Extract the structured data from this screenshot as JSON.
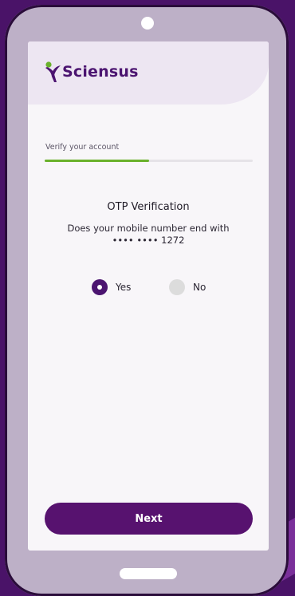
{
  "brand": {
    "name": "Sciensus",
    "primary_color": "#4b1470",
    "accent_color": "#6ab12c",
    "logo_icon": "sciensus-figure-icon"
  },
  "progress": {
    "label": "Verify your account",
    "fraction": 0.5
  },
  "otp": {
    "title": "OTP Verification",
    "question": "Does your mobile number end with",
    "masked_number": "•••• •••• 1272"
  },
  "options": [
    {
      "label": "Yes",
      "selected": true
    },
    {
      "label": "No",
      "selected": false
    }
  ],
  "actions": {
    "next_label": "Next"
  }
}
